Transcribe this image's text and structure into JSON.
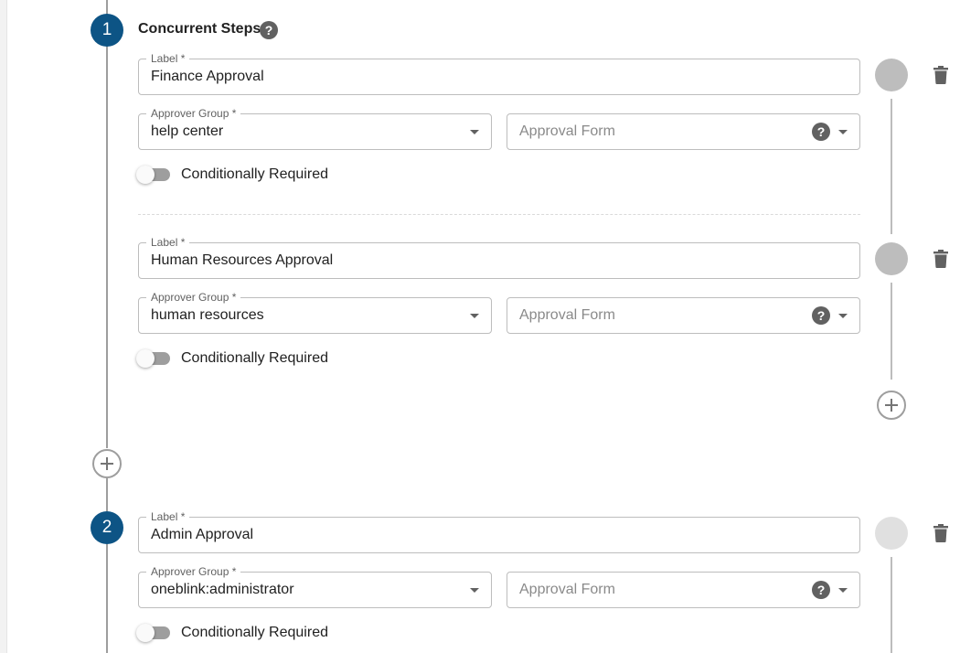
{
  "colors": {
    "step_circle": "#0d5485",
    "timeline": "#9e9e9e",
    "dot_grey": "#bdbdbd",
    "dot_light": "#e0e0e0"
  },
  "step1": {
    "number": "1",
    "title": "Concurrent Steps",
    "help_icon": "question-circle-icon",
    "substeps": [
      {
        "label_caption": "Label *",
        "label_value": "Finance Approval",
        "group_caption": "Approver Group *",
        "group_value": "help center",
        "form_placeholder": "Approval Form",
        "toggle_label": "Conditionally Required"
      },
      {
        "label_caption": "Label *",
        "label_value": "Human Resources Approval",
        "group_caption": "Approver Group *",
        "group_value": "human resources",
        "form_placeholder": "Approval Form",
        "toggle_label": "Conditionally Required"
      }
    ]
  },
  "step2": {
    "number": "2",
    "label_caption": "Label *",
    "label_value": "Admin Approval",
    "group_caption": "Approver Group *",
    "group_value": "oneblink:administrator",
    "form_placeholder": "Approval Form",
    "toggle_label": "Conditionally Required"
  },
  "icons": {
    "add": "plus-circle-icon",
    "delete": "trash-icon",
    "dropdown": "caret-down-icon"
  }
}
